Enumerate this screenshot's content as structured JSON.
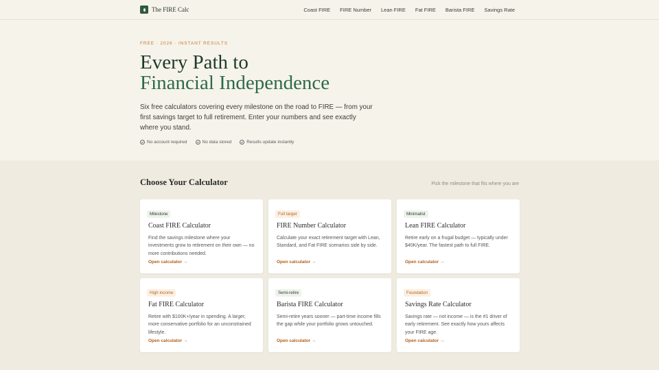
{
  "brand": {
    "name": "The FIRE Calc",
    "icon": "leaf-icon",
    "color": "#2f5a3f"
  },
  "nav": {
    "links": [
      "Coast FIRE",
      "FIRE Number",
      "Lean FIRE",
      "Fat FIRE",
      "Barista FIRE",
      "Savings Rate"
    ]
  },
  "hero": {
    "eyebrow": "FREE · 2026 · INSTANT RESULTS",
    "title_line1": "Every Path to",
    "title_line2": "Financial Independence",
    "description": "Six free calculators covering every milestone on the road to FIRE — from your first savings target to full retirement. Enter your numbers and see exactly where you stand.",
    "features": [
      "No account required",
      "No data stored",
      "Results update instantly"
    ]
  },
  "section": {
    "title": "Choose Your Calculator",
    "subtitle": "Pick the milestone that fits where you are"
  },
  "cards": [
    {
      "badge": "Milestone",
      "badge_tone": "green",
      "title": "Coast FIRE Calculator",
      "description": "Find the savings milestone where your investments grow to retirement on their own — no more contributions needed.",
      "link": "Open calculator →"
    },
    {
      "badge": "Full target",
      "badge_tone": "orange",
      "title": "FIRE Number Calculator",
      "description": "Calculate your exact retirement target with Lean, Standard, and Fat FIRE scenarios side by side.",
      "link": "Open calculator →"
    },
    {
      "badge": "Minimalist",
      "badge_tone": "green",
      "title": "Lean FIRE Calculator",
      "description": "Retire early on a frugal budget — typically under $40K/year. The fastest path to full FIRE.",
      "link": "Open calculator →"
    },
    {
      "badge": "High income",
      "badge_tone": "orange",
      "title": "Fat FIRE Calculator",
      "description": "Retire with $100K+/year in spending. A larger, more conservative portfolio for an unconstrained lifestyle.",
      "link": "Open calculator →"
    },
    {
      "badge": "Semi-retire",
      "badge_tone": "green",
      "title": "Barista FIRE Calculator",
      "description": "Semi-retire years sooner — part-time income fills the gap while your portfolio grows untouched.",
      "link": "Open calculator →"
    },
    {
      "badge": "Foundation",
      "badge_tone": "orange",
      "title": "Savings Rate Calculator",
      "description": "Savings rate — not income — is the #1 driver of early retirement. See exactly how yours affects your FIRE age.",
      "link": "Open calculator →"
    }
  ],
  "colors": {
    "accent": "#c47a3a",
    "link": "#b0601f",
    "title_dark": "#1f3a2a",
    "title_green": "#2d6a4a"
  }
}
